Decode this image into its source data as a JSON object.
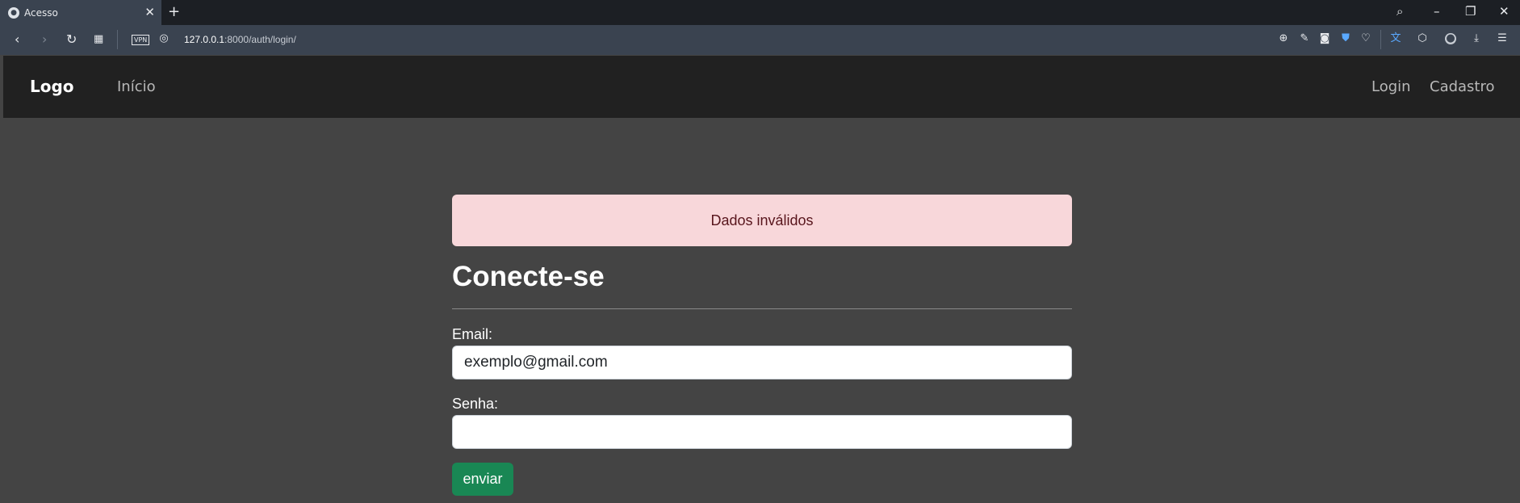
{
  "browser": {
    "tab_title": "Acesso",
    "url_host": "127.0.0.1",
    "url_rest": ":8000/auth/login/",
    "vpn_label": "VPN",
    "new_tab_glyph": "+",
    "icons": [
      "back-icon",
      "forward-icon",
      "reload-icon",
      "tabs-grid-icon",
      "globe-icon",
      "zoom-icon",
      "edit-icon",
      "camera-icon",
      "shield-icon",
      "heart-icon",
      "translate-icon",
      "cube-icon",
      "profile-icon",
      "download-icon",
      "menu-icon",
      "search-icon",
      "minimize-icon",
      "restore-icon",
      "close-icon"
    ]
  },
  "navbar": {
    "logo": "Logo",
    "home": "Início",
    "login": "Login",
    "signup": "Cadastro"
  },
  "alert": {
    "message": "Dados inválidos",
    "bg_color": "#f8d7da"
  },
  "form": {
    "title": "Conecte-se",
    "email_label": "Email:",
    "email_value": "exemplo@gmail.com",
    "password_label": "Senha:",
    "password_value": "",
    "submit_label": "enviar",
    "submit_color": "#198754"
  }
}
